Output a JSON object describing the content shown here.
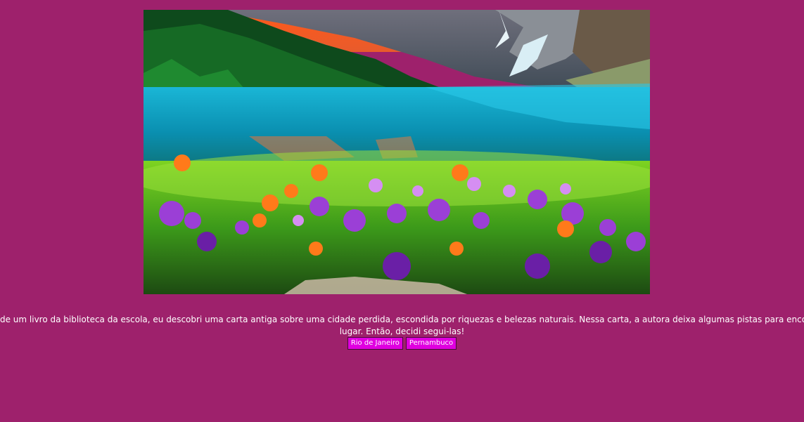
{
  "hero": {
    "icon": "landscape-image"
  },
  "story": {
    "text": "Dentro de um livro da biblioteca da escola, eu descobri uma carta antiga sobre uma cidade perdida, escondida por riquezas e belezas naturais. Nessa carta, a autora deixa algumas pistas para encontrar o lugar. Então, decidi segui-las!"
  },
  "choices": {
    "first_label": "Rio de Janeiro",
    "second_label": "Pernambuco"
  },
  "colors": {
    "background": "#9e216c",
    "button": "#e000e0"
  }
}
